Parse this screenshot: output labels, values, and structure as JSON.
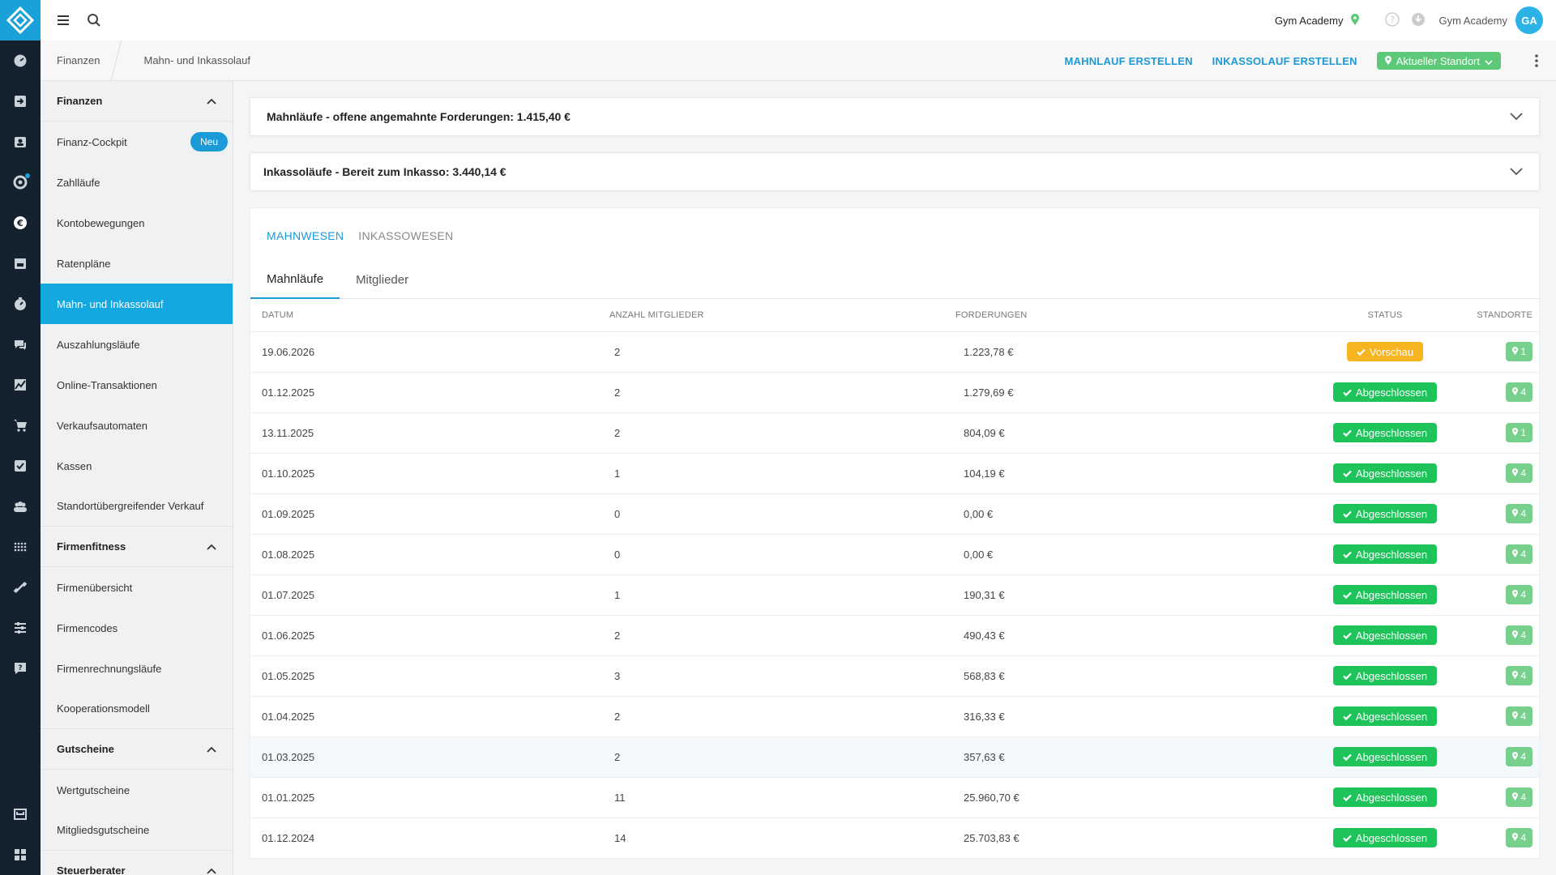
{
  "topbar": {
    "studio_name": "Gym Academy",
    "user_name": "Gym Academy",
    "avatar_initials": "GA"
  },
  "breadcrumb": {
    "items": [
      "Finanzen",
      "Mahn- und Inkassolauf"
    ]
  },
  "actions": {
    "create_dunning": "MAHNLAUF ERSTELLEN",
    "create_collection": "INKASSOLAUF ERSTELLEN",
    "location_filter": "Aktueller Standort"
  },
  "sidebar": {
    "groups": [
      {
        "label": "Finanzen"
      },
      {
        "label": "Firmenfitness"
      },
      {
        "label": "Gutscheine"
      },
      {
        "label": "Steuerberater"
      }
    ],
    "finanzen_items": [
      {
        "label": "Finanz-Cockpit",
        "badge": "Neu"
      },
      {
        "label": "Zahlläufe"
      },
      {
        "label": "Kontobewegungen"
      },
      {
        "label": "Ratenpläne"
      },
      {
        "label": "Mahn- und Inkassolauf",
        "active": true
      },
      {
        "label": "Auszahlungsläufe"
      },
      {
        "label": "Online-Transaktionen"
      },
      {
        "label": "Verkaufsautomaten"
      },
      {
        "label": "Kassen"
      },
      {
        "label": "Standortübergreifender Verkauf"
      }
    ],
    "firmen_items": [
      {
        "label": "Firmenübersicht"
      },
      {
        "label": "Firmencodes"
      },
      {
        "label": "Firmenrechnungsläufe"
      },
      {
        "label": "Kooperationsmodell"
      }
    ],
    "gutschein_items": [
      {
        "label": "Wertgutscheine"
      },
      {
        "label": "Mitgliedsgutscheine"
      }
    ]
  },
  "panels": {
    "dunning_summary": "Mahnläufe - offene angemahnte Forderungen: 1.415,40 €",
    "collection_summary": "Inkassoläufe - Bereit zum Inkasso: 3.440,14 €"
  },
  "tabs": {
    "top": [
      "MAHNWESEN",
      "INKASSOWESEN"
    ],
    "sub": [
      "Mahnläufe",
      "Mitglieder"
    ]
  },
  "table": {
    "headers": [
      "DATUM",
      "ANZAHL MITGLIEDER",
      "FORDERUNGEN",
      "STATUS",
      "STANDORTE"
    ],
    "rows": [
      {
        "date": "19.06.2026",
        "count": "2",
        "claims": "1.223,78 €",
        "status": "Vorschau",
        "locations": "1"
      },
      {
        "date": "01.12.2025",
        "count": "2",
        "claims": "1.279,69 €",
        "status": "Abgeschlossen",
        "locations": "4"
      },
      {
        "date": "13.11.2025",
        "count": "2",
        "claims": "804,09 €",
        "status": "Abgeschlossen",
        "locations": "1"
      },
      {
        "date": "01.10.2025",
        "count": "1",
        "claims": "104,19 €",
        "status": "Abgeschlossen",
        "locations": "4"
      },
      {
        "date": "01.09.2025",
        "count": "0",
        "claims": "0,00 €",
        "status": "Abgeschlossen",
        "locations": "4"
      },
      {
        "date": "01.08.2025",
        "count": "0",
        "claims": "0,00 €",
        "status": "Abgeschlossen",
        "locations": "4"
      },
      {
        "date": "01.07.2025",
        "count": "1",
        "claims": "190,31 €",
        "status": "Abgeschlossen",
        "locations": "4"
      },
      {
        "date": "01.06.2025",
        "count": "2",
        "claims": "490,43 €",
        "status": "Abgeschlossen",
        "locations": "4"
      },
      {
        "date": "01.05.2025",
        "count": "3",
        "claims": "568,83 €",
        "status": "Abgeschlossen",
        "locations": "4"
      },
      {
        "date": "01.04.2025",
        "count": "2",
        "claims": "316,33 €",
        "status": "Abgeschlossen",
        "locations": "4"
      },
      {
        "date": "01.03.2025",
        "count": "2",
        "claims": "357,63 €",
        "status": "Abgeschlossen",
        "locations": "4"
      },
      {
        "date": "01.01.2025",
        "count": "11",
        "claims": "25.960,70 €",
        "status": "Abgeschlossen",
        "locations": "4"
      },
      {
        "date": "01.12.2024",
        "count": "14",
        "claims": "25.703,83 €",
        "status": "Abgeschlossen",
        "locations": "4"
      }
    ]
  },
  "colors": {
    "brand": "#1aa1d9",
    "rail": "#13222e",
    "status_done": "#1ec45a",
    "status_preview": "#f5b420",
    "location_pill": "#77d18d"
  }
}
